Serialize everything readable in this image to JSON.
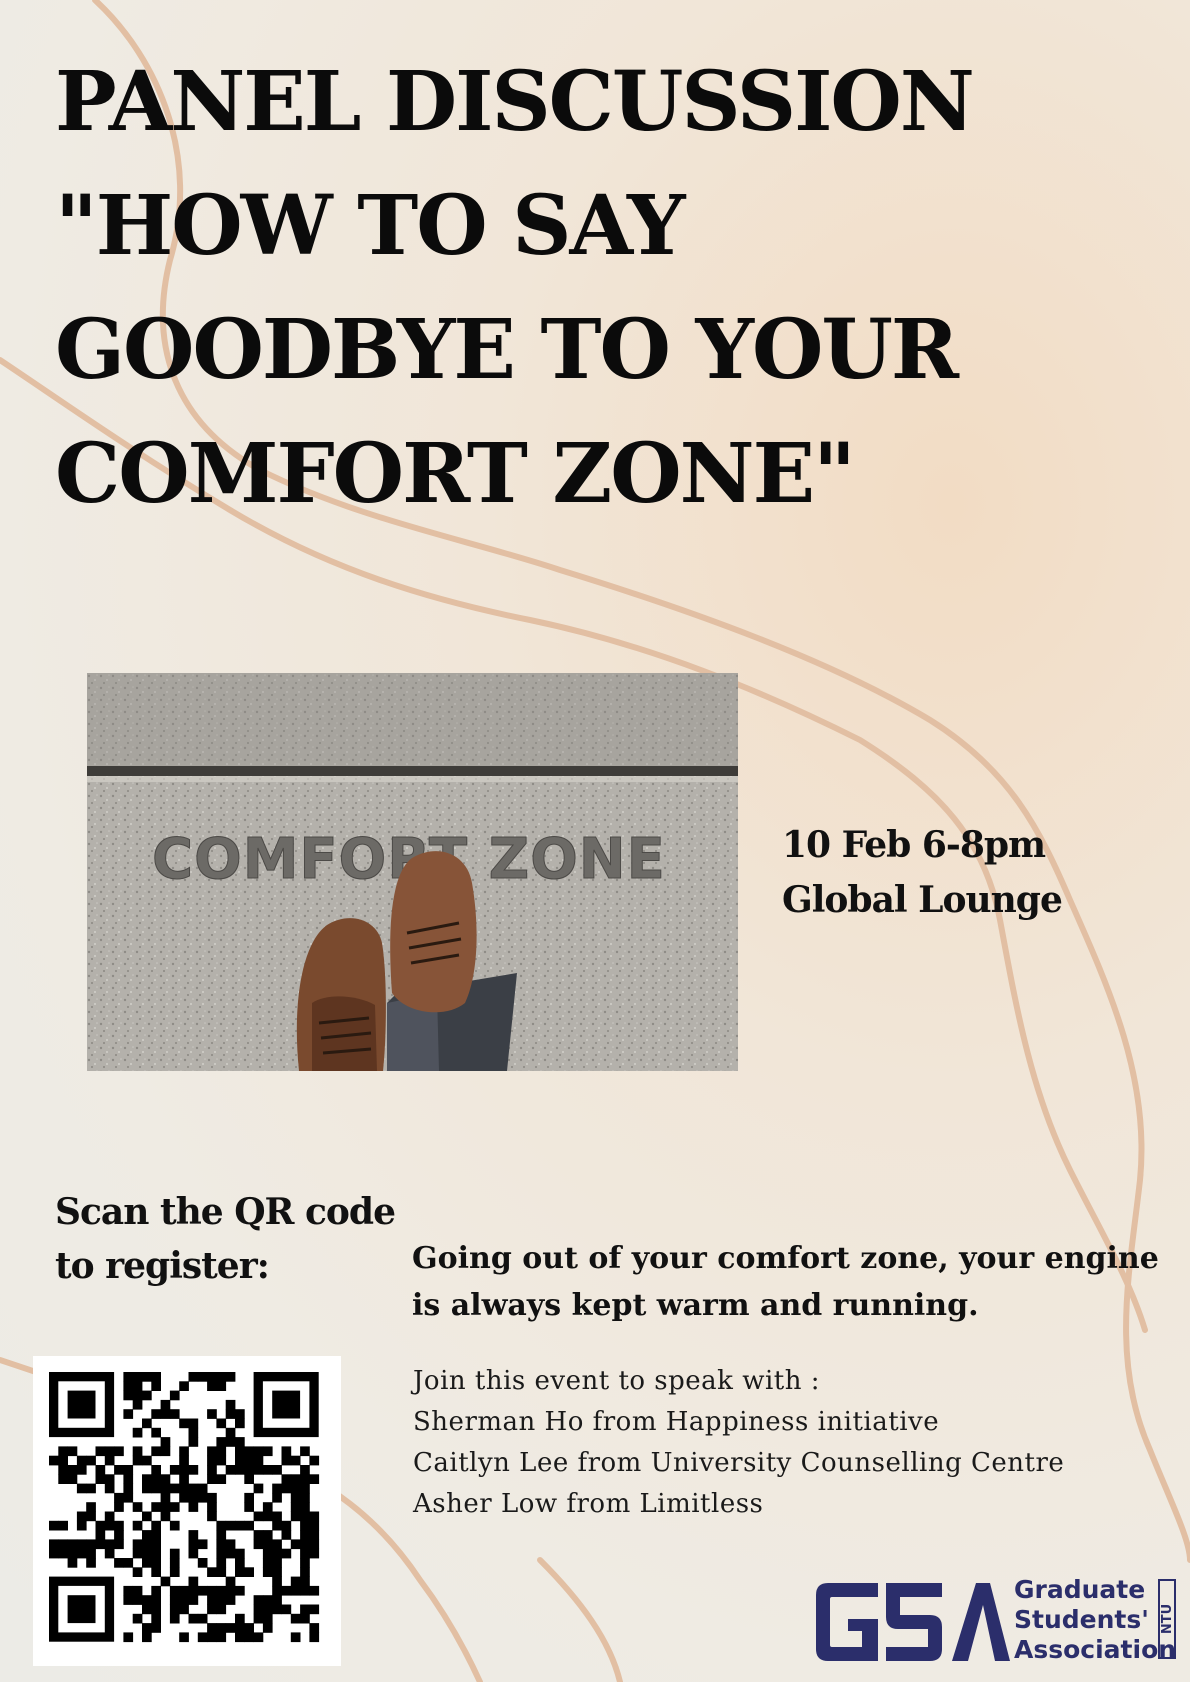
{
  "title": {
    "line1": "PANEL DISCUSSION",
    "line2": "\"HOW TO SAY",
    "line3": "GOODBYE TO YOUR",
    "line4": "COMFORT ZONE\""
  },
  "photo": {
    "floor_text": "COMFORT ZONE"
  },
  "event": {
    "date_time": "10 Feb 6-8pm",
    "venue": "Global Lounge"
  },
  "register": {
    "line1": "Scan the QR code",
    "line2": "to register:"
  },
  "tagline": {
    "line1": "Going out of your comfort zone, your engine",
    "line2": "is always kept warm and running."
  },
  "speakers": {
    "intro": "Join this event to speak with :",
    "list": [
      "Sherman Ho from Happiness initiative",
      "Caitlyn Lee from University Counselling Centre",
      "Asher Low from Limitless"
    ]
  },
  "logo": {
    "mark": "GSA",
    "line1": "Graduate",
    "line2": "Students'",
    "line3": "Association",
    "side": "NTU",
    "color": "#2b2e6b"
  },
  "colors": {
    "curve": "#e2bfa3",
    "title": "#0b0b0b"
  },
  "icons": {
    "qr": "qr-code-icon",
    "shoes": "shoes-icon"
  }
}
